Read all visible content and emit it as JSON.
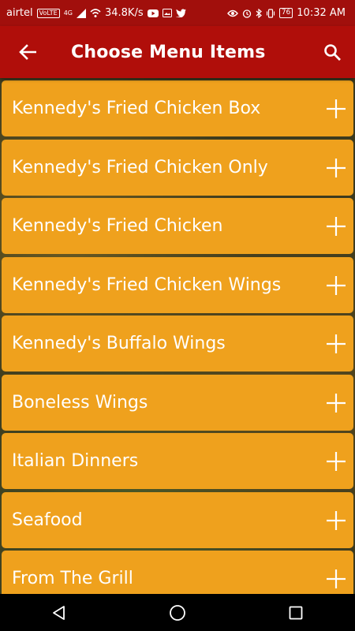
{
  "status_bar": {
    "carrier": "airtel",
    "volte": "VoLTE",
    "network": "4G",
    "speed": "34.8K/s",
    "battery": "76",
    "time": "10:32 AM",
    "icons": [
      "wifi-icon",
      "youtube-icon",
      "gallery-icon",
      "twitter-icon",
      "eye-icon",
      "alarm-icon",
      "bluetooth-icon",
      "vibrate-icon"
    ]
  },
  "app_bar": {
    "title": "Choose Menu Items",
    "back_icon": "back-arrow-icon",
    "search_icon": "search-icon"
  },
  "menu_items": [
    "Kennedy's Fried Chicken Box",
    "Kennedy's Fried Chicken Only",
    "Kennedy's Fried Chicken",
    "Kennedy's Fried Chicken Wings",
    "Kennedy's Buffalo Wings",
    "Boneless Wings",
    "Italian Dinners",
    "Seafood",
    "From The Grill"
  ],
  "nav_bar": {
    "icons": [
      "back-triangle-icon",
      "home-circle-icon",
      "recents-square-icon"
    ]
  },
  "colors": {
    "status_bar": "#a10f0c",
    "app_bar": "#b00e0a",
    "item_background": "#efa11d",
    "item_text": "#ffffff"
  }
}
